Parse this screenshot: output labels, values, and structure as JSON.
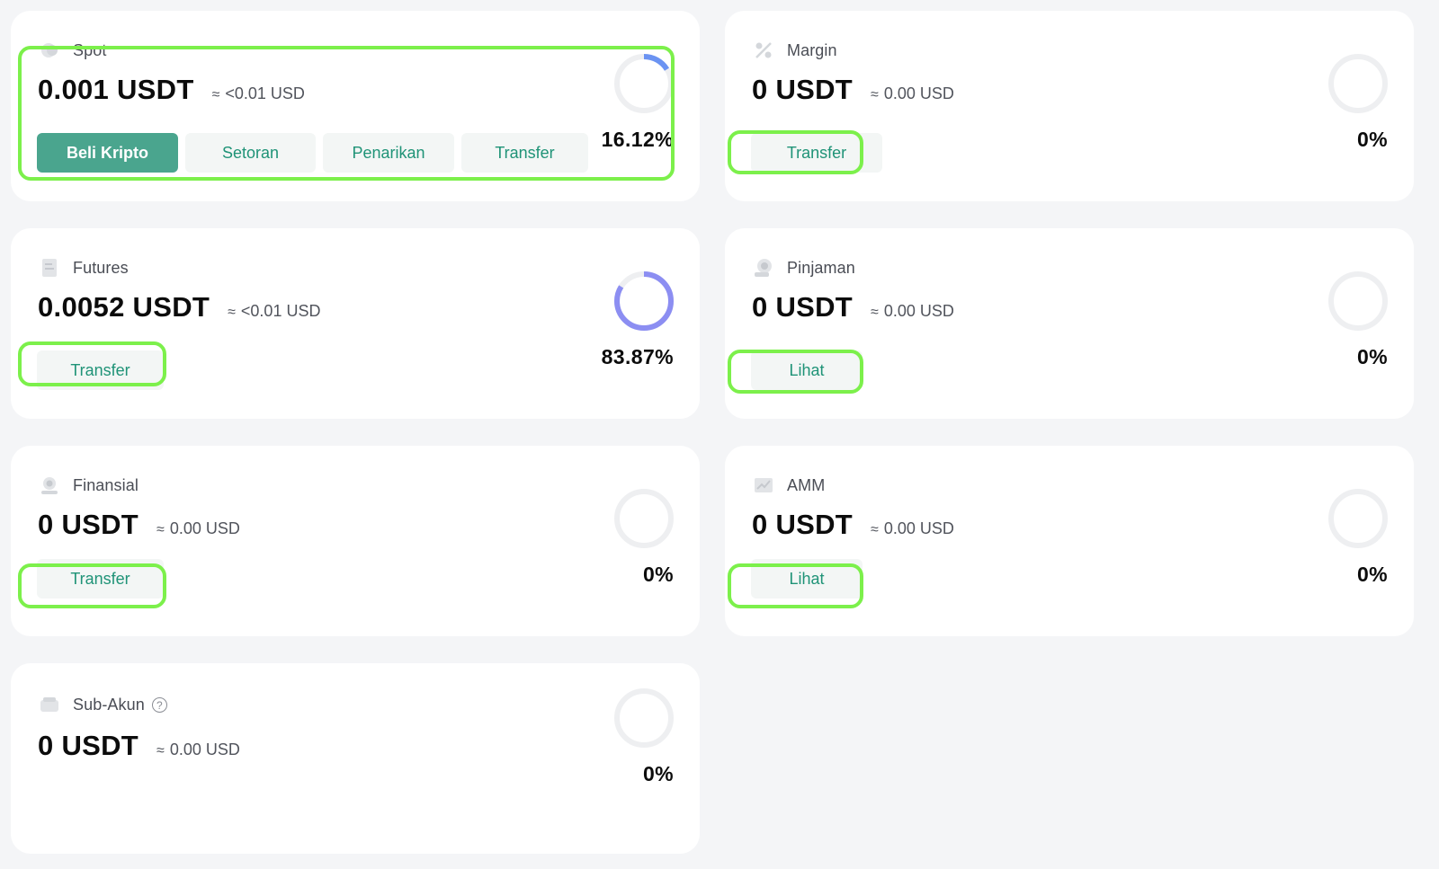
{
  "accent_color": "#4aa58e",
  "highlight_color": "#7cf04b",
  "accounts": {
    "spot": {
      "name": "Spot",
      "icon": "spot-coin-icon",
      "balance": "0.001 USDT",
      "approx": "≈",
      "usd": "<0.01 USD",
      "percent_label": "16.12%",
      "percent": 16.12,
      "ring_color": "#6b93f2",
      "buttons": {
        "buy": "Beli Kripto",
        "deposit": "Setoran",
        "withdraw": "Penarikan",
        "transfer": "Transfer"
      }
    },
    "margin": {
      "name": "Margin",
      "icon": "margin-percent-icon",
      "balance": "0 USDT",
      "approx": "≈",
      "usd": "0.00 USD",
      "percent_label": "0%",
      "percent": 0,
      "buttons": {
        "transfer": "Transfer"
      }
    },
    "futures": {
      "name": "Futures",
      "icon": "futures-document-icon",
      "balance": "0.0052 USDT",
      "approx": "≈",
      "usd": "<0.01 USD",
      "percent_label": "83.87%",
      "percent": 83.87,
      "ring_color": "#8c8ef2",
      "buttons": {
        "transfer": "Transfer"
      }
    },
    "pinjaman": {
      "name": "Pinjaman",
      "icon": "loan-icon",
      "balance": "0 USDT",
      "approx": "≈",
      "usd": "0.00 USD",
      "percent_label": "0%",
      "percent": 0,
      "buttons": {
        "view": "Lihat"
      }
    },
    "finansial": {
      "name": "Finansial",
      "icon": "finance-icon",
      "balance": "0 USDT",
      "approx": "≈",
      "usd": "0.00 USD",
      "percent_label": "0%",
      "percent": 0,
      "buttons": {
        "transfer": "Transfer"
      }
    },
    "amm": {
      "name": "AMM",
      "icon": "amm-chart-icon",
      "balance": "0 USDT",
      "approx": "≈",
      "usd": "0.00 USD",
      "percent_label": "0%",
      "percent": 0,
      "buttons": {
        "view": "Lihat"
      }
    },
    "subakun": {
      "name": "Sub-Akun",
      "icon": "sub-account-wallet-icon",
      "help_icon": "question-icon",
      "balance": "0 USDT",
      "approx": "≈",
      "usd": "0.00 USD",
      "percent_label": "0%",
      "percent": 0
    }
  }
}
